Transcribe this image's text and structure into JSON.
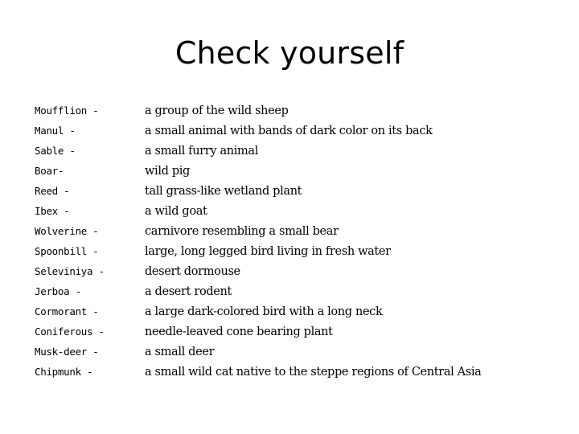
{
  "slide": {
    "title": "Check yourself",
    "background_color": "#ffffff",
    "text_color": "#000000",
    "entries": [
      {
        "term": "Moufflion -",
        "definition": "a group of the wild sheep"
      },
      {
        "term": "Manul -",
        "definition": "a small animal with bands of dark color on its back"
      },
      {
        "term": "Sable -",
        "definition": "a small furry animal"
      },
      {
        "term": "Boar-",
        "definition": "wild pig"
      },
      {
        "term": "Reed -",
        "definition": "tall grass-like wetland plant"
      },
      {
        "term": "Ibex -",
        "definition": "a wild goat"
      },
      {
        "term": "Wolverine -",
        "definition": "carnivore resembling a small bear"
      },
      {
        "term": "Spoonbill -",
        "definition": "large, long legged bird living in fresh water"
      },
      {
        "term": "Seleviniya -",
        "definition": "desert dormouse"
      },
      {
        "term": "Jerboa -",
        "definition": "a desert rodent"
      },
      {
        "term": "Cormorant -",
        "definition": "a large dark-colored bird with a long neck"
      },
      {
        "term": "Coniferous -",
        "definition": "needle-leaved cone bearing plant"
      },
      {
        "term": "Musk-deer -",
        "definition": "a small deer"
      },
      {
        "term": "Chipmunk -",
        "definition": "a small wild cat native to the steppe regions of Central Asia"
      }
    ]
  }
}
